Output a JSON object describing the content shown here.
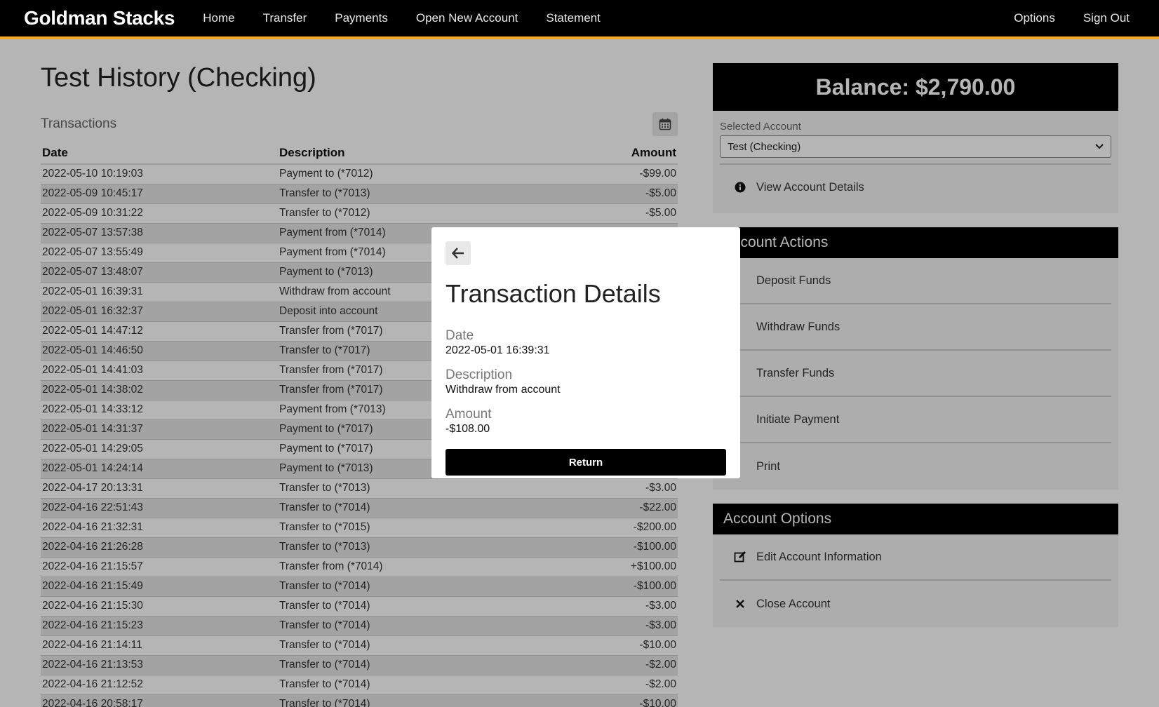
{
  "nav": {
    "brand": "Goldman Stacks",
    "links": [
      "Home",
      "Transfer",
      "Payments",
      "Open New Account",
      "Statement"
    ],
    "right": [
      "Options",
      "Sign Out"
    ]
  },
  "page": {
    "title": "Test History (Checking)",
    "transactions_label": "Transactions",
    "columns": [
      "Date",
      "Description",
      "Amount"
    ],
    "rows": [
      [
        "2022-05-10 10:19:03",
        "Payment to (*7012)",
        "-$99.00"
      ],
      [
        "2022-05-09 10:45:17",
        "Transfer to (*7013)",
        "-$5.00"
      ],
      [
        "2022-05-09 10:31:22",
        "Transfer to (*7012)",
        "-$5.00"
      ],
      [
        "2022-05-07 13:57:38",
        "Payment from (*7014)",
        ""
      ],
      [
        "2022-05-07 13:55:49",
        "Payment from (*7014)",
        ""
      ],
      [
        "2022-05-07 13:48:07",
        "Payment to (*7013)",
        ""
      ],
      [
        "2022-05-01 16:39:31",
        "Withdraw from account",
        ""
      ],
      [
        "2022-05-01 16:32:37",
        "Deposit into account",
        ""
      ],
      [
        "2022-05-01 14:47:12",
        "Transfer from (*7017)",
        ""
      ],
      [
        "2022-05-01 14:46:50",
        "Transfer to (*7017)",
        ""
      ],
      [
        "2022-05-01 14:41:03",
        "Transfer from (*7017)",
        ""
      ],
      [
        "2022-05-01 14:38:02",
        "Transfer from (*7017)",
        ""
      ],
      [
        "2022-05-01 14:33:12",
        "Payment from (*7013)",
        ""
      ],
      [
        "2022-05-01 14:31:37",
        "Payment to (*7017)",
        ""
      ],
      [
        "2022-05-01 14:29:05",
        "Payment to (*7017)",
        ""
      ],
      [
        "2022-05-01 14:24:14",
        "Payment to (*7013)",
        ""
      ],
      [
        "2022-04-17 20:13:31",
        "Transfer to (*7013)",
        "-$3.00"
      ],
      [
        "2022-04-16 22:51:43",
        "Transfer to (*7014)",
        "-$22.00"
      ],
      [
        "2022-04-16 21:32:31",
        "Transfer to (*7015)",
        "-$200.00"
      ],
      [
        "2022-04-16 21:26:28",
        "Transfer to (*7013)",
        "-$100.00"
      ],
      [
        "2022-04-16 21:15:57",
        "Transfer from (*7014)",
        "+$100.00"
      ],
      [
        "2022-04-16 21:15:49",
        "Transfer to (*7014)",
        "-$100.00"
      ],
      [
        "2022-04-16 21:15:30",
        "Transfer to (*7014)",
        "-$3.00"
      ],
      [
        "2022-04-16 21:15:23",
        "Transfer to (*7014)",
        "-$3.00"
      ],
      [
        "2022-04-16 21:14:11",
        "Transfer to (*7014)",
        "-$10.00"
      ],
      [
        "2022-04-16 21:13:53",
        "Transfer to (*7014)",
        "-$2.00"
      ],
      [
        "2022-04-16 21:12:52",
        "Transfer to (*7014)",
        "-$2.00"
      ],
      [
        "2022-04-16 20:58:17",
        "Transfer to (*7014)",
        "-$10.00"
      ]
    ]
  },
  "sidebar": {
    "balance": "Balance: $2,790.00",
    "selected_account_label": "Selected Account",
    "selected_account_value": "Test (Checking)",
    "view_details": "View Account Details",
    "actions_title": "Account Actions",
    "actions": [
      "Deposit Funds",
      "Withdraw Funds",
      "Transfer Funds",
      "Initiate Payment",
      "Print"
    ],
    "options_title": "Account Options",
    "options": [
      "Edit Account Information",
      "Close Account"
    ]
  },
  "modal": {
    "title": "Transaction Details",
    "date_label": "Date",
    "date_value": "2022-05-01 16:39:31",
    "description_label": "Description",
    "description_value": "Withdraw from account",
    "amount_label": "Amount",
    "amount_value": "-$108.00",
    "return_label": "Return"
  },
  "icons": [
    "calendar-icon",
    "info-icon",
    "edit-icon",
    "close-icon",
    "arrow-left-icon",
    "chevron-down-icon"
  ],
  "colors": {
    "navbar": "#000000",
    "accent": "#f5a623",
    "overlay": "rgba(0,0,0,0.29)"
  }
}
